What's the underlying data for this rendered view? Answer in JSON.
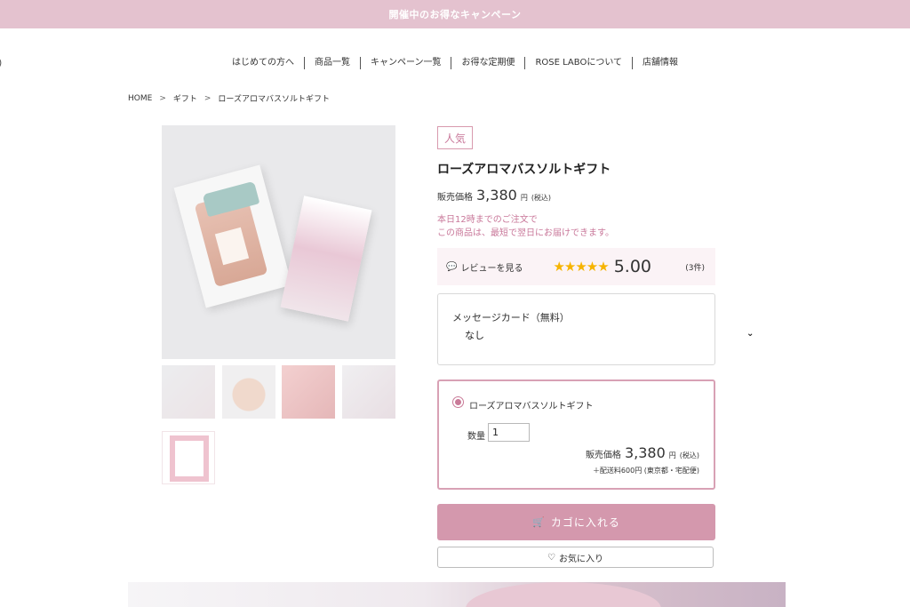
{
  "banner": {
    "text": "開催中のお得なキャンペーン"
  },
  "edge_mark": ")",
  "nav": {
    "items": [
      {
        "label": "はじめての方へ"
      },
      {
        "label": "商品一覧"
      },
      {
        "label": "キャンペーン一覧"
      },
      {
        "label": "お得な定期便"
      },
      {
        "label": "ROSE LABOについて"
      },
      {
        "label": "店舗情報"
      }
    ]
  },
  "breadcrumb": {
    "items": [
      "HOME",
      "ギフト",
      "ローズアロマバスソルトギフト"
    ],
    "separator": ">"
  },
  "product": {
    "badge": "人気",
    "title": "ローズアロマバスソルトギフト",
    "price_label": "販売価格",
    "price": "3,380",
    "price_unit": "円",
    "tax_note": "(税込)",
    "delivery_line1": "本日12時までのご注文で",
    "delivery_line2": "この商品は、最短で翌日にお届けできます。"
  },
  "review": {
    "link_label": "レビューを見る",
    "stars": "★★★★★",
    "rating": "5.00",
    "count": "(3件)",
    "rating_value": 5
  },
  "message_card": {
    "label": "メッセージカード（無料）",
    "value": "なし",
    "chevron": "⌄"
  },
  "variant": {
    "name": "ローズアロマバスソルトギフト",
    "qty_label": "数量",
    "qty_value": "1",
    "price_label": "販売価格",
    "price": "3,380",
    "price_unit": "円",
    "tax_note": "(税込)",
    "shipping": "＋配送料600円 (東京都・宅配便)"
  },
  "buttons": {
    "cart_icon": "🛒",
    "cart_label": "カゴに入れる",
    "fav_icon": "♡",
    "fav_label": "お気に入り"
  },
  "colors": {
    "accent": "#d498ad",
    "banner": "#e4c2cf",
    "accent_text": "#c9789a",
    "star": "#f6b400"
  }
}
